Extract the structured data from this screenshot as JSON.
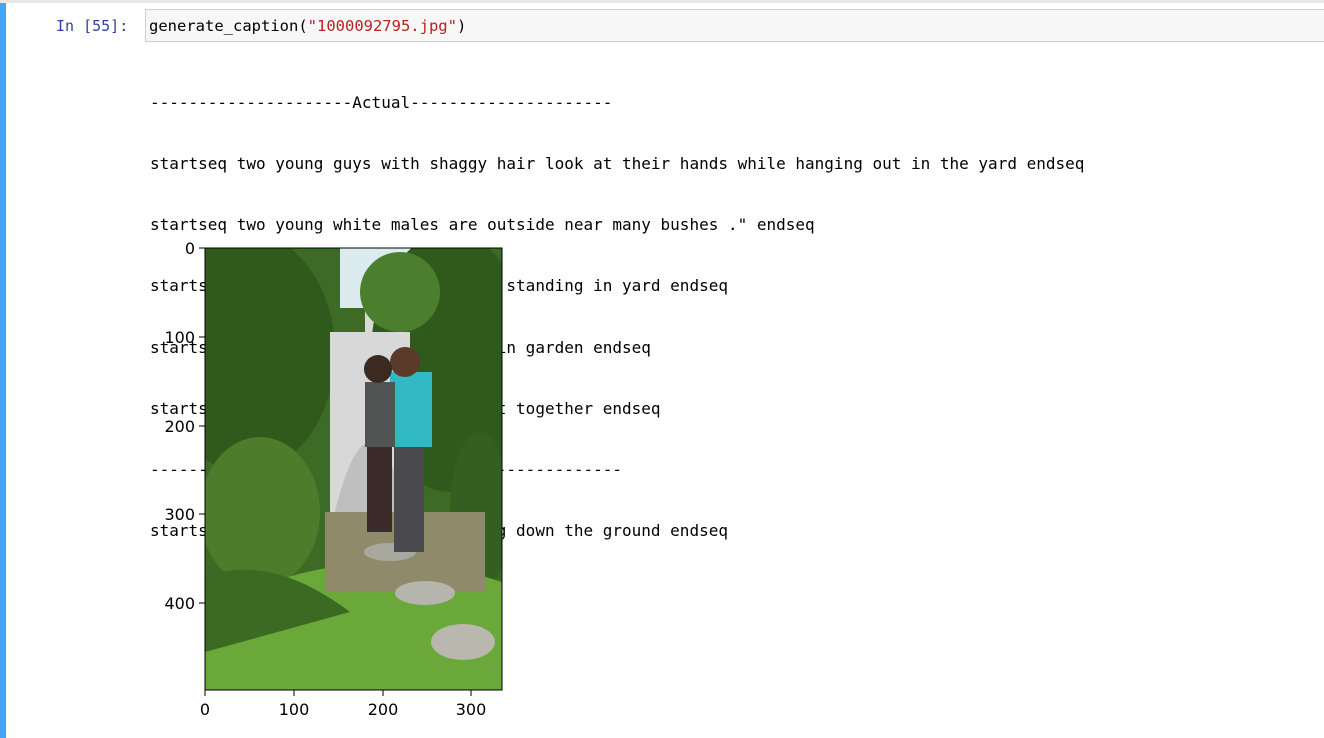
{
  "cell": {
    "prompt": "In [55]:",
    "code": {
      "function": "generate_caption",
      "open_paren": "(",
      "argument": "\"1000092795.jpg\"",
      "close_paren": ")"
    }
  },
  "output": {
    "lines": [
      "---------------------Actual---------------------",
      "startseq two young guys with shaggy hair look at their hands while hanging out in the yard endseq",
      "startseq two young white males are outside near many bushes .\" endseq",
      "startseq two men in green shirts are standing in yard endseq",
      "startseq man in blue shirt standing in garden endseq",
      "startseq two friends enjoy time spent together endseq",
      "--------------------Predicted--------------------",
      "startseq man in blue shirt is walking down the ground endseq"
    ]
  },
  "plot": {
    "y_ticks": [
      "0",
      "100",
      "200",
      "300",
      "400"
    ],
    "x_ticks": [
      "0",
      "100",
      "200",
      "300"
    ],
    "image_description": "photo of two young men standing in a garden",
    "colors": {
      "sky": "#dcebf0",
      "foliage": "#2f5a1c",
      "lawn": "#6aa83a",
      "shirt": "#31b9c4"
    }
  }
}
